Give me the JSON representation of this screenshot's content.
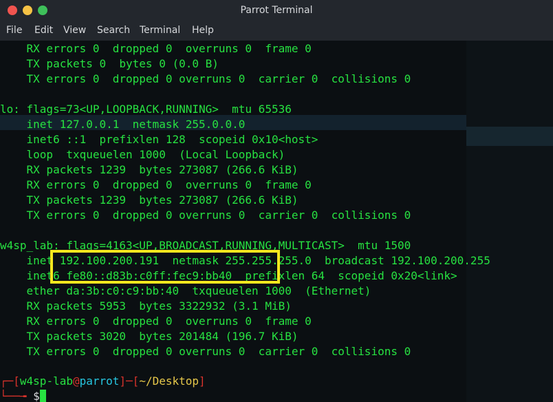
{
  "window": {
    "title": "Parrot Terminal"
  },
  "menu": [
    "File",
    "Edit",
    "View",
    "Search",
    "Terminal",
    "Help"
  ],
  "output": [
    "    RX errors 0  dropped 0  overruns 0  frame 0",
    "    TX packets 0  bytes 0 (0.0 B)",
    "    TX errors 0  dropped 0 overruns 0  carrier 0  collisions 0",
    "",
    "lo: flags=73<UP,LOOPBACK,RUNNING>  mtu 65536",
    "    inet 127.0.0.1  netmask 255.0.0.0",
    "    inet6 ::1  prefixlen 128  scopeid 0x10<host>",
    "    loop  txqueuelen 1000  (Local Loopback)",
    "    RX packets 1239  bytes 273087 (266.6 KiB)",
    "    RX errors 0  dropped 0  overruns 0  frame 0",
    "    TX packets 1239  bytes 273087 (266.6 KiB)",
    "    TX errors 0  dropped 0 overruns 0  carrier 0  collisions 0",
    "",
    "w4sp_lab: flags=4163<UP,BROADCAST,RUNNING,MULTICAST>  mtu 1500",
    "    inet 192.100.200.191  netmask 255.255.255.0  broadcast 192.100.200.255",
    "    inet6 fe80::d83b:c0ff:fec9:bb40  prefixlen 64  scopeid 0x20<link>",
    "    ether da:3b:c0:c9:bb:40  txqueuelen 1000  (Ethernet)",
    "    RX packets 5953  bytes 3322932 (3.1 MiB)",
    "    RX errors 0  dropped 0  overruns 0  frame 0",
    "    TX packets 3020  bytes 201484 (196.7 KiB)",
    "    TX errors 0  dropped 0 overruns 0  carrier 0  collisions 0",
    ""
  ],
  "prompt": {
    "open": "┌─[",
    "user": "w4sp-lab",
    "at": "@",
    "host": "parrot",
    "mid": "]─[",
    "path": "~/Desktop",
    "close": "]",
    "line2": "└──╼ ",
    "dollar": "$"
  },
  "colors": {
    "terminal_text": "#27e241",
    "highlight_box": "#f6e71e",
    "prompt_bracket": "#d7322b"
  }
}
